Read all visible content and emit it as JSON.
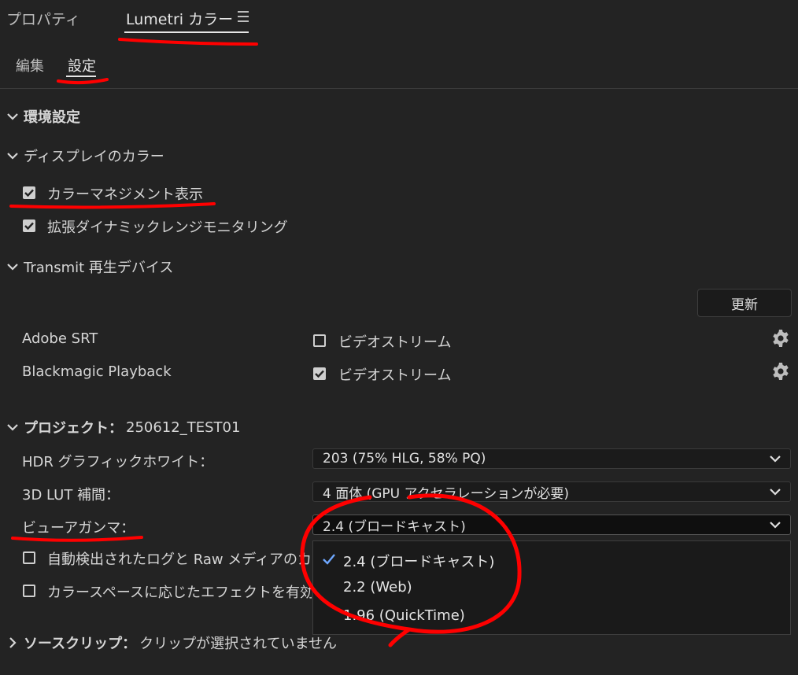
{
  "panel_tabs": {
    "properties": "プロパティ",
    "lumetri": "Lumetri カラー"
  },
  "sub_tabs": {
    "edit": "編集",
    "settings": "設定"
  },
  "sections": {
    "env": "環境設定",
    "display_color": "ディスプレイのカラー",
    "transmit": "Transmit 再生デバイス",
    "project_label": "プロジェクト：",
    "project_name": "250612_TEST01",
    "source_label": "ソースクリップ：",
    "source_value": "クリップが選択されていません"
  },
  "display": {
    "color_mgmt": "カラーマネジメント表示",
    "hdr_monitor": "拡張ダイナミックレンジモニタリング"
  },
  "transmit": {
    "refresh": "更新",
    "devices": [
      {
        "name": "Adobe SRT",
        "stream": "ビデオストリーム",
        "checked": false
      },
      {
        "name": "Blackmagic Playback",
        "stream": "ビデオストリーム",
        "checked": true
      }
    ]
  },
  "project": {
    "hdr_white_label": "HDR グラフィックホワイト：",
    "hdr_white_value": "203 (75% HLG, 58% PQ)",
    "lut_label": "3D LUT 補間：",
    "lut_value": "4 面体 (GPU アクセラレーションが必要)",
    "gamma_label": "ビューアガンマ：",
    "gamma_value": "2.4 (ブロードキャスト)",
    "auto_detect": "自動検出されたログと Raw メディアのカ",
    "color_space_effect": "カラースペースに応じたエフェクトを有効"
  },
  "gamma_options": [
    "2.4 (ブロードキャスト)",
    "2.2 (Web)",
    "1.96 (QuickTime)"
  ],
  "colors": {
    "accent_check": "#6fa8ff",
    "annotation": "#ff0000"
  }
}
